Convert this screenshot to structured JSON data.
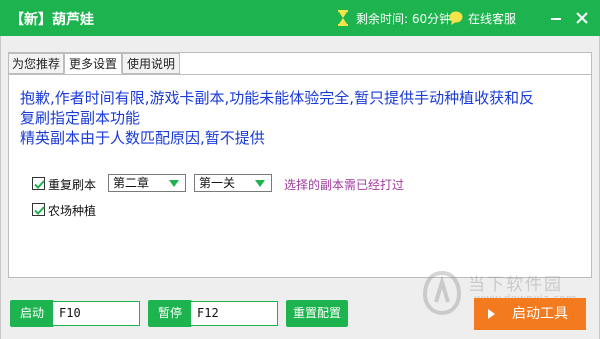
{
  "titlebar": {
    "title": "【新】葫芦娃",
    "timer_text": "剩余时间: 60分钟",
    "service_text": "在线客服",
    "bg_color": "#1db34e"
  },
  "tabs": [
    {
      "label": "为您推荐",
      "active": false
    },
    {
      "label": "更多设置",
      "active": true
    },
    {
      "label": "使用说明",
      "active": false
    }
  ],
  "notice": {
    "line1": "抱歉,作者时间有限,游戏卡副本,功能未能体验完全,暂只提供手动种植收获和反",
    "line2": "复刷指定副本功能",
    "line3": "精英副本由于人数匹配原因,暂不提供"
  },
  "options": {
    "repeat_dungeon": {
      "label": "重复刷本",
      "checked": true
    },
    "chapter_select": {
      "value": "第二章"
    },
    "level_select": {
      "value": "第一关"
    },
    "hint": "选择的副本需已经打过",
    "farm_planting": {
      "label": "农场种植",
      "checked": true
    }
  },
  "bottom": {
    "start_label": "启动",
    "start_key": "F10",
    "pause_label": "暂停",
    "pause_key": "F12",
    "reset_label": "重置配置",
    "start_tool_label": "启动工具"
  },
  "watermark": {
    "text": "当下软件园",
    "url": "www.downxia.com"
  },
  "colors": {
    "accent_green": "#1db34e",
    "start_orange": "#f47a1f",
    "notice_blue": "#1a3bd6",
    "hint_purple": "#a33aa0"
  }
}
